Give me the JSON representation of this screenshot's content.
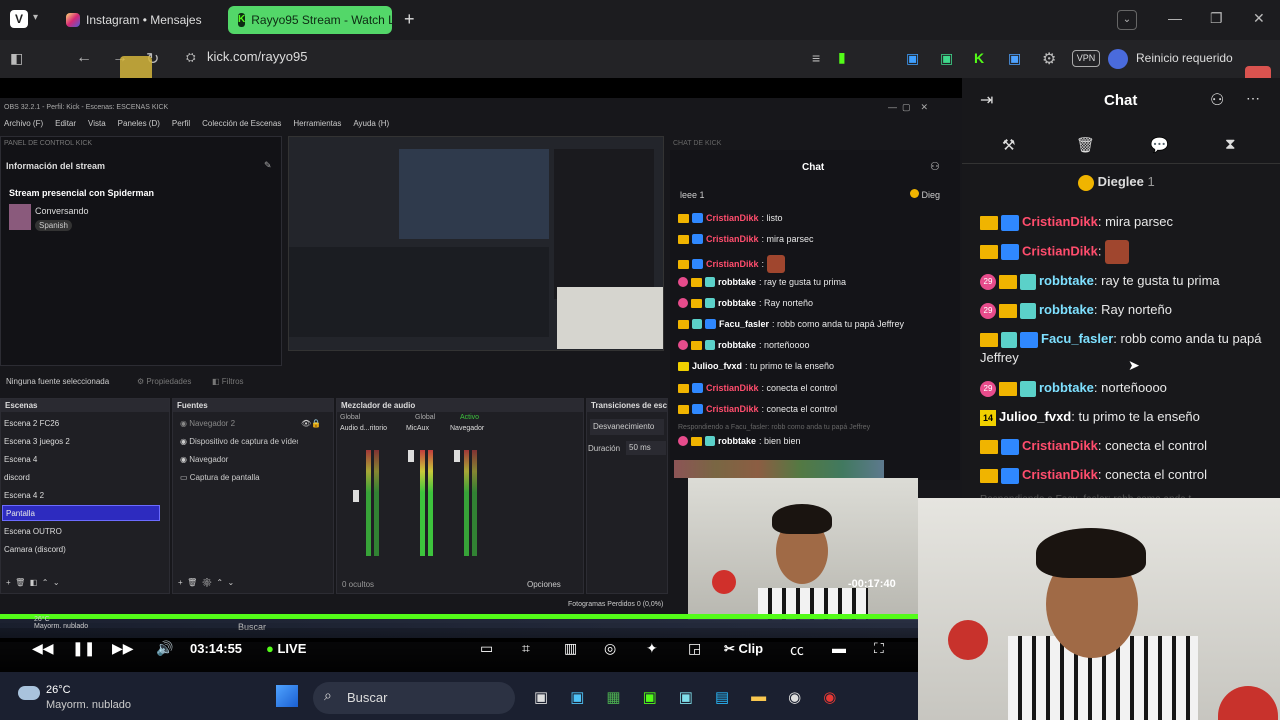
{
  "browser": {
    "tabs": [
      {
        "label": "Instagram • Mensajes"
      },
      {
        "label": "Rayyo95 Stream - Watch Li"
      }
    ],
    "url": "kick.com/rayyo95",
    "vpn_label": "VPN",
    "update_label": "Reinicio requerido"
  },
  "obs": {
    "title": "OBS 32.2.1 - Perfil: Kick - Escenas: ESCENAS KICK",
    "menu": [
      "Archivo (F)",
      "Editar",
      "Vista",
      "Paneles (D)",
      "Perfil",
      "Colección de Escenas",
      "Herramientas",
      "Ayuda (H)"
    ],
    "panel_control_label": "PANEL DE CONTROL KICK",
    "stream_info_label": "Información del stream",
    "stream_title": "Stream presencial con Spiderman",
    "category": "Conversando",
    "language": "Spanish",
    "chat_panel_label": "CHAT DE KICK",
    "chat_title": "Chat",
    "pinned_short": "leee 1",
    "pinned_user_short": "Dieg",
    "no_source_label": "Ninguna fuente seleccionada",
    "properties_label": "Propiedades",
    "filters_label": "Filtros",
    "scenes_label": "Escenas",
    "scenes": [
      "Escena 2 FC26",
      "Escena 3 juegos 2",
      "Escena 4",
      "discord",
      "Escena 4 2",
      "Pantalla",
      "Escena OUTRO",
      "Camara (discord)"
    ],
    "sources_label": "Fuentes",
    "sources": [
      "Navegador 2",
      "Dispositivo de captura de vídeo",
      "Navegador",
      "Captura de pantalla"
    ],
    "mixer_label": "Mezclador de audio",
    "mixer_channels": [
      "Audio d...ritorio",
      "MicAux",
      "Navegador"
    ],
    "mixer_tags": [
      "Global",
      "Global",
      "Activo"
    ],
    "transitions_label": "Transiciones de esc",
    "transition": "Desvanecimiento",
    "duration_label": "Duración",
    "duration": "50 ms",
    "hidden_label": "0 ocultos",
    "options_label": "Opciones",
    "frames_dropped": "Fotogramas Perdidos 0 (0,0%)",
    "chat_lines": [
      {
        "user": "CristianDikk",
        "msg": ": listo"
      },
      {
        "user": "CristianDikk",
        "msg": ": mira parsec"
      },
      {
        "user": "CristianDikk",
        "msg": ":"
      },
      {
        "user": "robbtake",
        "msg": ": ray te gusta tu prima"
      },
      {
        "user": "robbtake",
        "msg": ": Ray norteño"
      },
      {
        "user": "Facu_fasler",
        "msg": ": robb como anda tu papá Jeffrey"
      },
      {
        "user": "robbtake",
        "msg": ": norteñoooo"
      },
      {
        "user": "Julioo_fvxd",
        "msg": ": tu primo te la enseño"
      },
      {
        "user": "CristianDikk",
        "msg": ": conecta el control"
      },
      {
        "user": "CristianDikk",
        "msg": ": conecta el control"
      },
      {
        "user": "robbtake",
        "msg": ": bien bien"
      }
    ],
    "reply_hint": "Respondiendo a Facu_fasler: robb como anda tu papá Jeffrey"
  },
  "player": {
    "timestamp": "03:14:55",
    "live_label": "LIVE",
    "clip_label": "Clip",
    "overlay_time": "-00:17:40",
    "progress": 1.0
  },
  "taskbar": {
    "temp": "26°C",
    "weather": "Mayorm. nublado",
    "search": "Buscar",
    "inner_temp": "26°C",
    "inner_weather": "Mayorm. nublado",
    "inner_search": "Buscar"
  },
  "chat": {
    "title": "Chat",
    "pinned_user": "Dieglee",
    "pinned_count": "1",
    "messages": [
      {
        "user": "CristianDikk",
        "msg": ": mira parsec",
        "color": "#ff4d6d",
        "badges": [
          "crown",
          "bolt"
        ]
      },
      {
        "user": "CristianDikk",
        "msg": ":",
        "color": "#ff4d6d",
        "badges": [
          "crown",
          "bolt"
        ],
        "emote": true
      },
      {
        "user": "robbtake",
        "msg": ": ray te gusta tu prima",
        "color": "#7ee0ff",
        "badges": [
          "sub29",
          "hand",
          "bot"
        ]
      },
      {
        "user": "robbtake",
        "msg": ": Ray norteño",
        "color": "#7ee0ff",
        "badges": [
          "sub29",
          "hand",
          "bot"
        ]
      },
      {
        "user": "Facu_fasler",
        "msg": ": robb como anda tu papá Jeffrey",
        "color": "#7ee0ff",
        "badges": [
          "crown",
          "bot",
          "bolt"
        ]
      },
      {
        "user": "robbtake",
        "msg": ": norteñoooo",
        "color": "#7ee0ff",
        "badges": [
          "sub29",
          "hand",
          "bot"
        ]
      },
      {
        "user": "Julioo_fvxd",
        "msg": ": tu primo te la enseño",
        "color": "#ffffff",
        "badges": [
          "sub14"
        ]
      },
      {
        "user": "CristianDikk",
        "msg": ": conecta el control",
        "color": "#ff4d6d",
        "badges": [
          "crown",
          "bolt"
        ]
      },
      {
        "user": "CristianDikk",
        "msg": ": conecta el control",
        "color": "#ff4d6d",
        "badges": [
          "crown",
          "bolt"
        ]
      }
    ],
    "reply_hint": "Respondiendo a Facu_fasler: robb como anda t"
  },
  "colors": {
    "kick_green": "#53fc18",
    "red_user": "#ff4d6d",
    "cyan_user": "#7ee0ff"
  }
}
